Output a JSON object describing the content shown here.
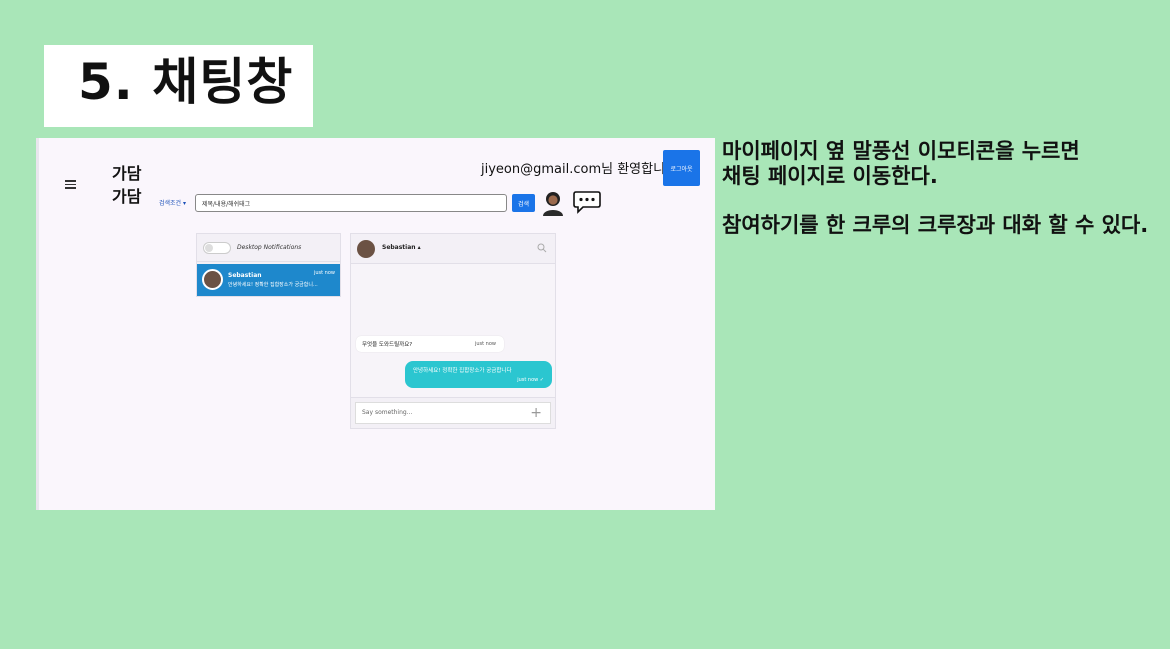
{
  "slide": {
    "title": "5. 채팅창",
    "caption_line1": "마이페이지 옆 말풍선 이모티콘을 누르면",
    "caption_line2": "채팅 페이지로 이동한다.",
    "caption_line3": "참여하기를 한 크루의 크루장과 대화 할 수 있다."
  },
  "app": {
    "logo_line1": "가담",
    "logo_line2": "가담",
    "welcome": "jiyeon@gmail.com님 환영합니다!",
    "logout_label": "로그아웃",
    "search_condition": "검색조건 ▾",
    "search_placeholder": "제목/내용/해쉬태그",
    "search_button": "검색",
    "profile_icon": "user-icon",
    "chat_icon": "speech-bubble-icon"
  },
  "chat": {
    "notifications_label": "Desktop Notifications",
    "contact": {
      "name": "Sebastian",
      "preview": "안녕하세요! 정확한 집합장소가 궁금합니...",
      "time": "just now"
    },
    "header_name": "Sebastian ▴",
    "messages": [
      {
        "direction": "in",
        "text": "무엇을 도와드릴까요?",
        "time": "just now"
      },
      {
        "direction": "out",
        "text": "안녕하세요! 정확한 집합장소가 궁금합니다",
        "time": "just now ✓"
      }
    ],
    "input_placeholder": "Say something...",
    "colors": {
      "primary": "#1a74e8",
      "contact_active": "#1e88cc",
      "outgoing": "#2bc6d0",
      "slide_bg": "#a9e6b8"
    }
  }
}
